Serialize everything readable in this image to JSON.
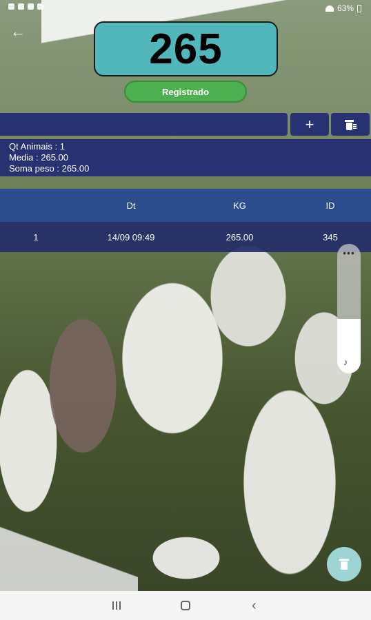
{
  "status_bar": {
    "battery": "63%"
  },
  "display": {
    "weight": "265",
    "status": "Registrado"
  },
  "toolbar": {
    "add_label": "+"
  },
  "summary": {
    "count": "Qt Animais : 1",
    "average": "Media : 265.00",
    "total_weight": "Soma peso : 265.00"
  },
  "table": {
    "headers": [
      "",
      "Dt",
      "KG",
      "ID"
    ],
    "rows": [
      [
        "1",
        "14/09 09:49",
        "265.00",
        "345"
      ]
    ]
  },
  "volume": {
    "dots": "•••",
    "level_fraction": 0.42
  },
  "colors": {
    "weight_box": "#52b7bb",
    "status_pill": "#4caf50",
    "navy": "#283272",
    "table_header": "#2b4d8e"
  },
  "icons": {
    "back": "arrow-left",
    "add": "plus",
    "clear": "delete-sweep",
    "fab": "trash"
  }
}
